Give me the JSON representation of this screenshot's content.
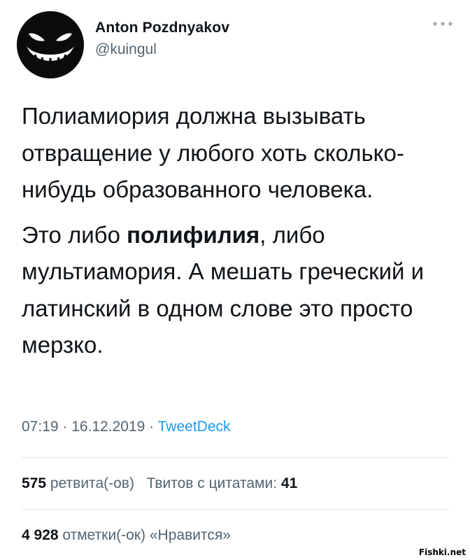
{
  "author": {
    "name": "Anton Pozdnyakov",
    "handle": "@kuingul",
    "avatar_icon": "grinning-face-icon"
  },
  "menu": {
    "icon": "more-icon",
    "label": "···"
  },
  "tweet": {
    "p1": "Полиамиория должна вызывать отвращение у любого хоть сколько-нибудь образованного человека.",
    "p2_before": "Это либо ",
    "p2_bold": "полифилия",
    "p2_after": ", либо мультиамория. А мешать греческий и латинский в одном слове это просто мерзко."
  },
  "meta": {
    "time": "07:19",
    "sep1": " · ",
    "date": "16.12.2019",
    "sep2": " · ",
    "source": "TweetDeck"
  },
  "stats": {
    "retweets_count": "575",
    "retweets_label": "ретвита(-ов)",
    "quotes_label": "Твитов с цитатами:",
    "quotes_count": "41",
    "likes_count": "4 928",
    "likes_label": "отметки(-ок) «Нравится»"
  },
  "watermark": "Fishki.net",
  "colors": {
    "text": "#0f1419",
    "secondary": "#536471",
    "link": "#1d9bf0",
    "divider": "#e1e6ea"
  }
}
